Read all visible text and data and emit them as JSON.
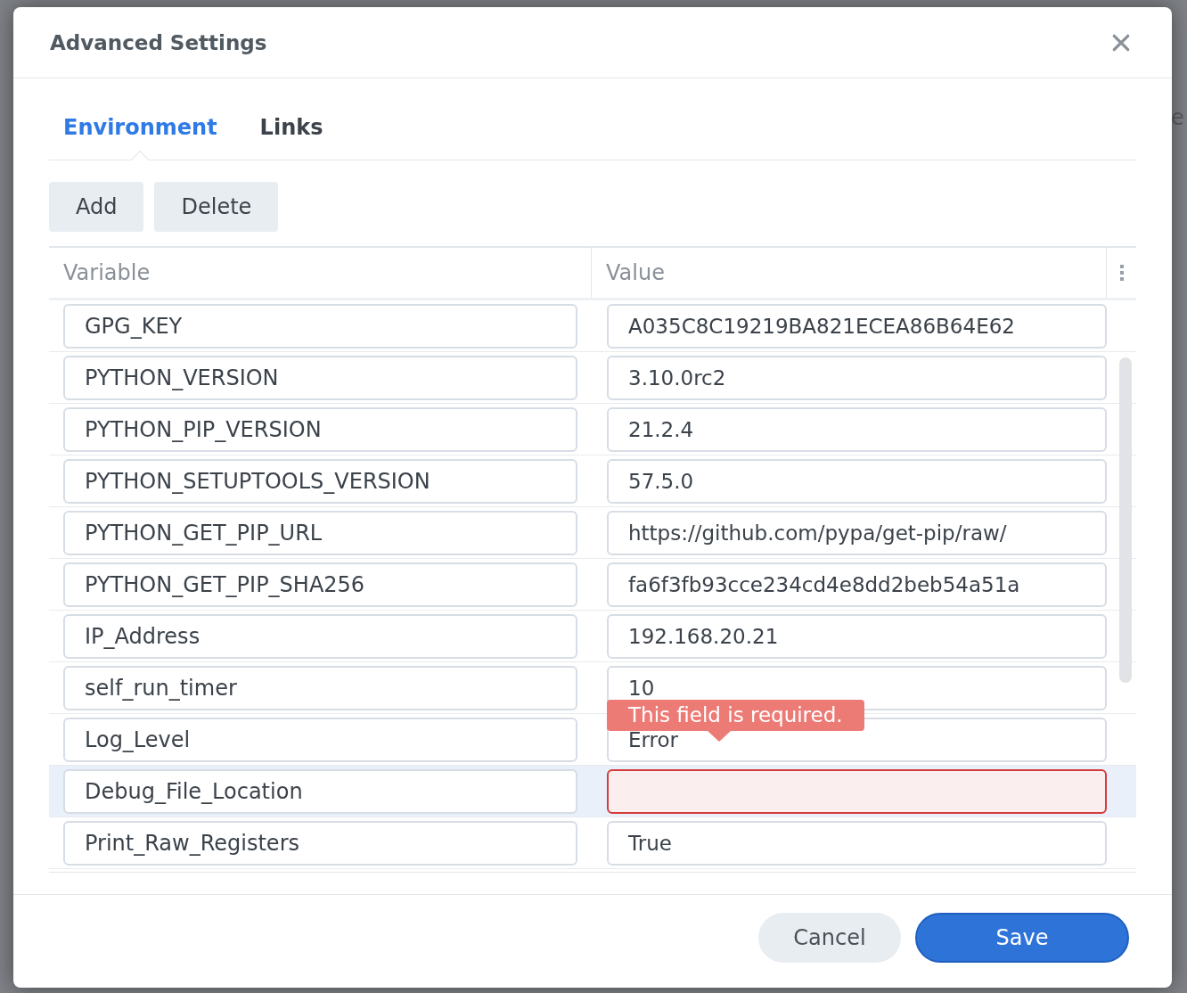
{
  "background": {
    "text_fragment": "e"
  },
  "dialog": {
    "title": "Advanced Settings"
  },
  "tabs": [
    {
      "label": "Environment",
      "selected": true
    },
    {
      "label": "Links",
      "selected": false
    }
  ],
  "toolbar": [
    "Add",
    "Delete"
  ],
  "table": {
    "columns": [
      "Variable",
      "Value"
    ],
    "rows": [
      {
        "variable": "GPG_KEY",
        "value": "A035C8C19219BA821ECEA86B64E62",
        "selected": false,
        "invalid": false
      },
      {
        "variable": "PYTHON_VERSION",
        "value": "3.10.0rc2",
        "selected": false,
        "invalid": false
      },
      {
        "variable": "PYTHON_PIP_VERSION",
        "value": "21.2.4",
        "selected": false,
        "invalid": false
      },
      {
        "variable": "PYTHON_SETUPTOOLS_VERSION",
        "value": "57.5.0",
        "selected": false,
        "invalid": false
      },
      {
        "variable": "PYTHON_GET_PIP_URL",
        "value": "https://github.com/pypa/get-pip/raw/",
        "selected": false,
        "invalid": false
      },
      {
        "variable": "PYTHON_GET_PIP_SHA256",
        "value": "fa6f3fb93cce234cd4e8dd2beb54a51a",
        "selected": false,
        "invalid": false
      },
      {
        "variable": "IP_Address",
        "value": "192.168.20.21",
        "selected": false,
        "invalid": false
      },
      {
        "variable": "self_run_timer",
        "value": "10",
        "selected": false,
        "invalid": false
      },
      {
        "variable": "Log_Level",
        "value": "Error",
        "selected": false,
        "invalid": false
      },
      {
        "variable": "Debug_File_Location",
        "selected": true,
        "invalid": true,
        "error_message": "This field is required."
      },
      {
        "variable": "Print_Raw_Registers",
        "value": "True",
        "selected": false,
        "invalid": false
      }
    ]
  },
  "buttons": [
    {
      "label": "Cancel",
      "kind": "secondary"
    },
    {
      "label": "Save",
      "kind": "primary"
    }
  ]
}
